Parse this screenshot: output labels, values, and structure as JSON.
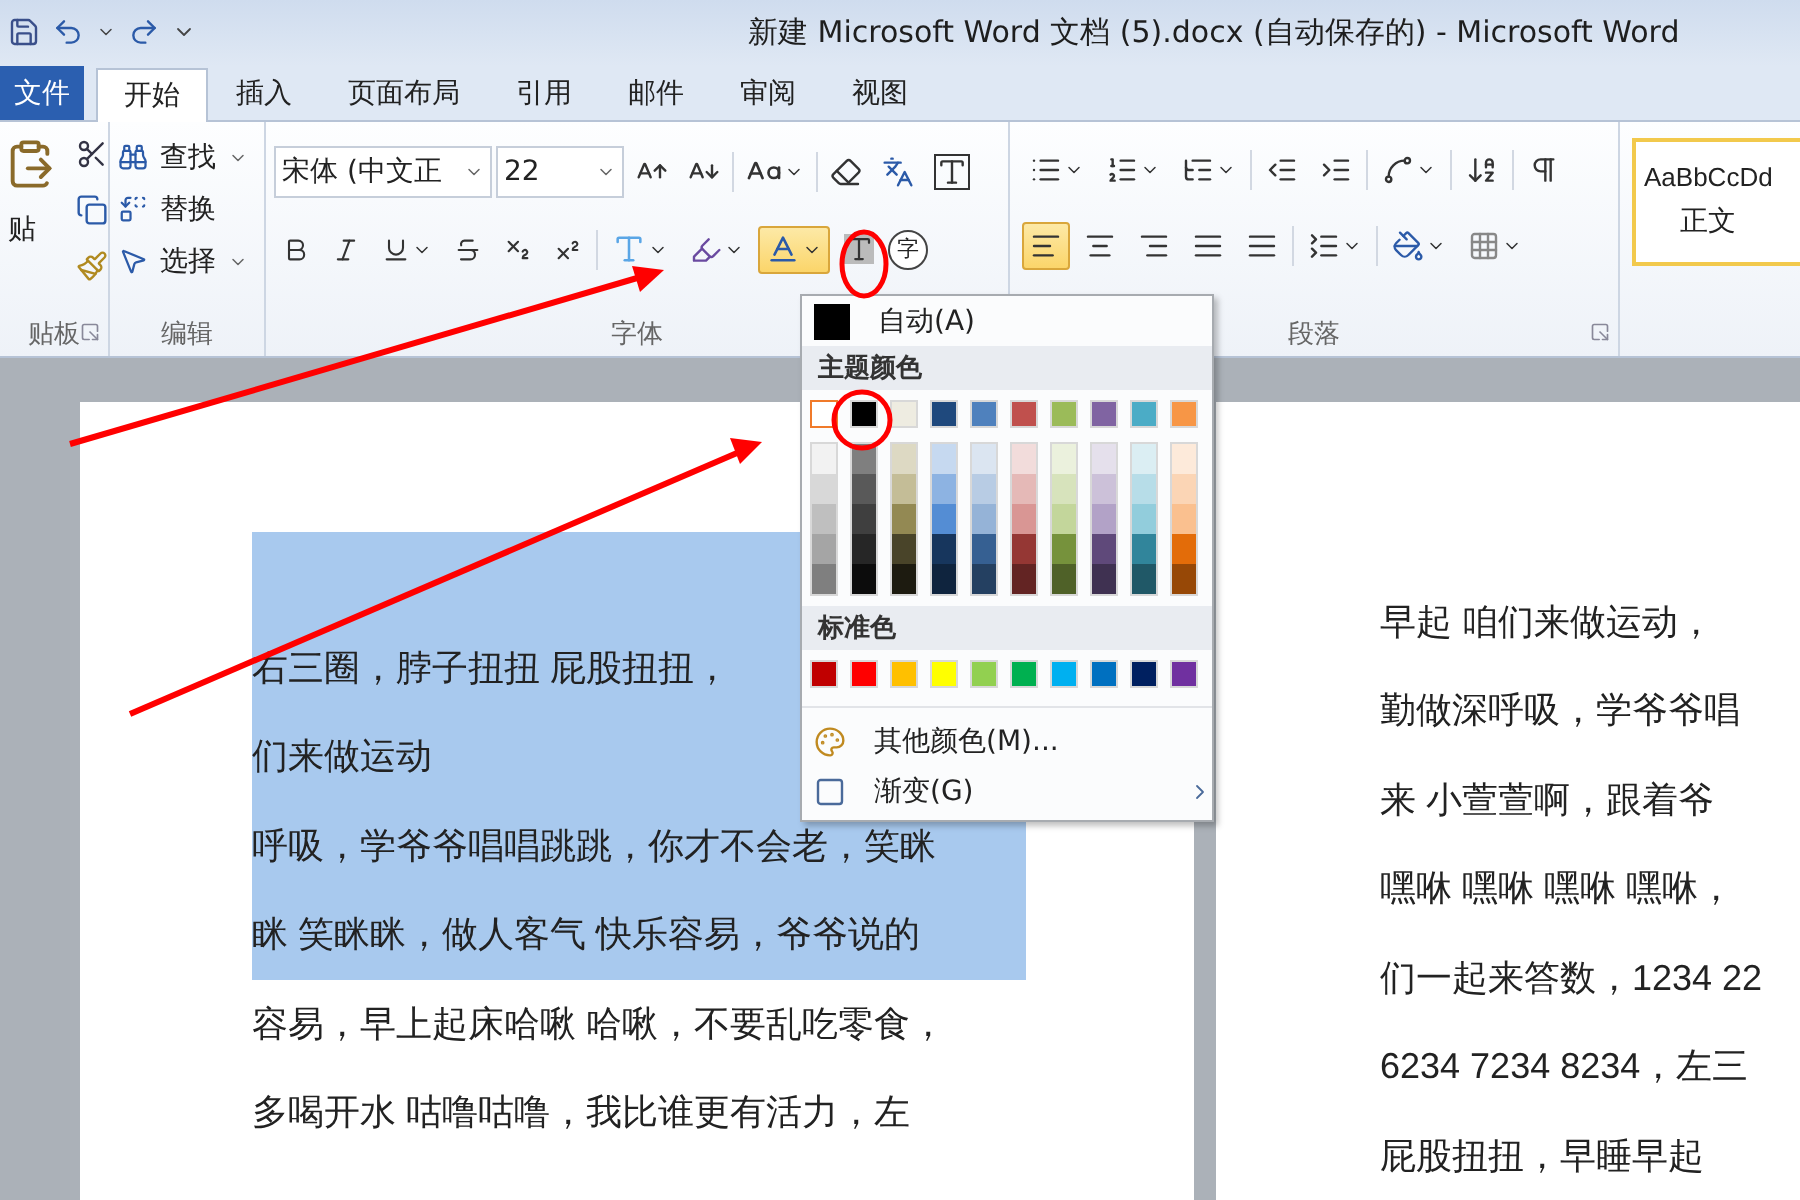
{
  "window": {
    "title": "新建 Microsoft Word 文档 (5).docx (自动保存的) - Microsoft Word"
  },
  "tabs": [
    {
      "label": "文件",
      "kind": "file",
      "selected": false
    },
    {
      "label": "开始",
      "kind": "tab",
      "selected": true
    },
    {
      "label": "插入",
      "kind": "tab",
      "selected": false
    },
    {
      "label": "页面布局",
      "kind": "tab",
      "selected": false
    },
    {
      "label": "引用",
      "kind": "tab",
      "selected": false
    },
    {
      "label": "邮件",
      "kind": "tab",
      "selected": false
    },
    {
      "label": "审阅",
      "kind": "tab",
      "selected": false
    },
    {
      "label": "视图",
      "kind": "tab",
      "selected": false
    }
  ],
  "ribbon": {
    "clipboard": {
      "paste_label": "贴",
      "group_label": "贴板"
    },
    "editing": {
      "items": [
        {
          "label": "查找",
          "kind": "find"
        },
        {
          "label": "替换",
          "kind": "replace"
        },
        {
          "label": "选择",
          "kind": "select"
        }
      ],
      "group_label": "编辑"
    },
    "font": {
      "font_name": "宋体 (中文正",
      "font_size": "22",
      "enclose_char": "字",
      "font_color_expanded": true,
      "group_label": "字体"
    },
    "paragraph": {
      "alignments": [
        {
          "kind": "left",
          "selected": true
        },
        {
          "kind": "center",
          "selected": false
        },
        {
          "kind": "right",
          "selected": false
        },
        {
          "kind": "justify",
          "selected": false
        },
        {
          "kind": "distributed",
          "selected": false
        }
      ],
      "group_label": "段落"
    },
    "styles": {
      "preview": "AaBbCcDd",
      "name": "正文",
      "selected": true
    }
  },
  "document": {
    "left_page": [
      {
        "text": "右三圈，脖子扭扭  屁股扭扭，",
        "selected": true
      },
      {
        "text": "们来做运动",
        "selected": true
      },
      {
        "text": "呼吸，学爷爷唱唱跳跳，你才不会老，笑眯",
        "selected": true
      },
      {
        "text": "眯  笑眯眯，做人客气  快乐容易，爷爷说的",
        "selected": true
      },
      {
        "text": "容易，早上起床哈啾  哈啾，不要乱吃零食，",
        "selected": false
      },
      {
        "text": "多喝开水  咕噜咕噜，我比谁更有活力，左",
        "selected": false
      }
    ],
    "right_page": [
      {
        "text": "早起  咱们来做运动，",
        "selected": false
      },
      {
        "text": "勤做深呼吸，学爷爷唱",
        "selected": false
      },
      {
        "text": "来  小萱萱啊，跟着爷",
        "selected": false
      },
      {
        "text": "嘿咻  嘿咻  嘿咻  嘿咻，",
        "selected": false
      },
      {
        "text": "们一起来答数，1234  22",
        "selected": false
      },
      {
        "text": "6234 7234 8234，左三",
        "selected": false
      },
      {
        "text": "屁股扭扭，早睡早起",
        "selected": false
      }
    ]
  },
  "color_menu": {
    "auto": {
      "label": "自动(A)",
      "color": "#000000"
    },
    "theme_heading": "主题颜色",
    "theme_colors": [
      {
        "color": "#ffffff",
        "selected": true,
        "shades": [
          {
            "color": "#f2f2f2"
          },
          {
            "color": "#d8d8d8"
          },
          {
            "color": "#bfbfbf"
          },
          {
            "color": "#a5a5a5"
          },
          {
            "color": "#7f7f7f"
          }
        ]
      },
      {
        "color": "#000000",
        "selected": false,
        "shades": [
          {
            "color": "#7f7f7f"
          },
          {
            "color": "#595959"
          },
          {
            "color": "#3f3f3f"
          },
          {
            "color": "#262626"
          },
          {
            "color": "#0c0c0c"
          }
        ]
      },
      {
        "color": "#eeece1",
        "selected": false,
        "shades": [
          {
            "color": "#ddd9c3"
          },
          {
            "color": "#c4bd97"
          },
          {
            "color": "#938953"
          },
          {
            "color": "#494429"
          },
          {
            "color": "#1d1b10"
          }
        ]
      },
      {
        "color": "#1f497d",
        "selected": false,
        "shades": [
          {
            "color": "#c6d9f0"
          },
          {
            "color": "#8db3e2"
          },
          {
            "color": "#548dd4"
          },
          {
            "color": "#17365d"
          },
          {
            "color": "#0f243e"
          }
        ]
      },
      {
        "color": "#4f81bd",
        "selected": false,
        "shades": [
          {
            "color": "#dbe5f1"
          },
          {
            "color": "#b8cce4"
          },
          {
            "color": "#95b3d7"
          },
          {
            "color": "#366092"
          },
          {
            "color": "#244061"
          }
        ]
      },
      {
        "color": "#c0504d",
        "selected": false,
        "shades": [
          {
            "color": "#f2dcdb"
          },
          {
            "color": "#e5b9b7"
          },
          {
            "color": "#d99694"
          },
          {
            "color": "#953734"
          },
          {
            "color": "#632423"
          }
        ]
      },
      {
        "color": "#9bbb59",
        "selected": false,
        "shades": [
          {
            "color": "#ebf1dd"
          },
          {
            "color": "#d7e3bc"
          },
          {
            "color": "#c3d69b"
          },
          {
            "color": "#76923c"
          },
          {
            "color": "#4f6128"
          }
        ]
      },
      {
        "color": "#8064a2",
        "selected": false,
        "shades": [
          {
            "color": "#e5e0ec"
          },
          {
            "color": "#ccc1d9"
          },
          {
            "color": "#b2a2c7"
          },
          {
            "color": "#5f497a"
          },
          {
            "color": "#3f3151"
          }
        ]
      },
      {
        "color": "#4bacc6",
        "selected": false,
        "shades": [
          {
            "color": "#dbeef3"
          },
          {
            "color": "#b7dde8"
          },
          {
            "color": "#92cddc"
          },
          {
            "color": "#31859b"
          },
          {
            "color": "#205867"
          }
        ]
      },
      {
        "color": "#f79646",
        "selected": false,
        "shades": [
          {
            "color": "#fdeada"
          },
          {
            "color": "#fbd5b5"
          },
          {
            "color": "#fac08f"
          },
          {
            "color": "#e36c09"
          },
          {
            "color": "#974806"
          }
        ]
      }
    ],
    "standard_heading": "标准色",
    "standard_colors": [
      {
        "color": "#c00000"
      },
      {
        "color": "#ff0000"
      },
      {
        "color": "#ffc000"
      },
      {
        "color": "#ffff00"
      },
      {
        "color": "#92d050"
      },
      {
        "color": "#00b050"
      },
      {
        "color": "#00b0f0"
      },
      {
        "color": "#0070c0"
      },
      {
        "color": "#002060"
      },
      {
        "color": "#7030a0"
      }
    ],
    "more_colors": "其他颜色(M)...",
    "gradient": "渐变(G)"
  }
}
